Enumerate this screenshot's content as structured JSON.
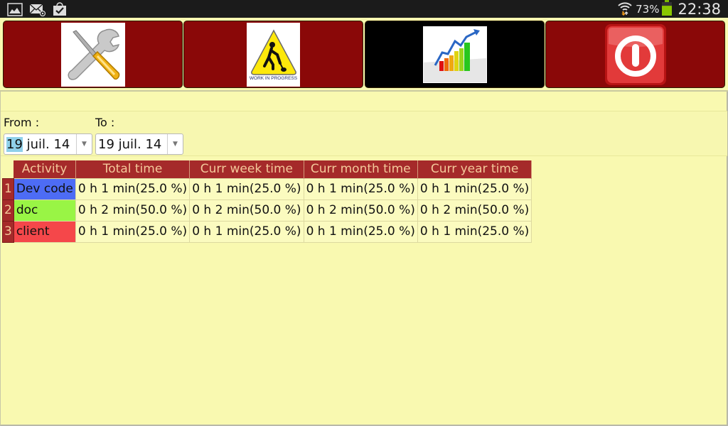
{
  "status_bar": {
    "left_icons": [
      "gallery-icon",
      "email-icon",
      "task-check-icon"
    ],
    "wifi_icon": "wifi-icon",
    "battery_percent": "73%",
    "battery_level": 0.73,
    "time": "22:38"
  },
  "toolbar": {
    "buttons": [
      {
        "name": "settings",
        "icon": "tools-icon"
      },
      {
        "name": "work-in-progress",
        "icon": "work-in-progress-icon",
        "icon_caption": "WORK IN PROGRESS"
      },
      {
        "name": "statistics",
        "icon": "growth-chart-icon"
      },
      {
        "name": "power",
        "icon": "power-icon"
      }
    ]
  },
  "filters": {
    "from_label": "From :",
    "from_value_day": "19",
    "from_value_rest": " juil. 14",
    "to_label": "To :",
    "to_value": "19 juil. 14"
  },
  "table": {
    "headers": [
      "Activity",
      "Total time",
      "Curr week time",
      "Curr month time",
      "Curr year time"
    ],
    "rows": [
      {
        "num": "1",
        "activity": "Dev code",
        "color": "#4d6cf5",
        "cells": [
          "0 h 1 min(25.0 %)",
          "0 h 1 min(25.0 %)",
          "0 h 1 min(25.0 %)",
          "0 h 1 min(25.0 %)"
        ]
      },
      {
        "num": "2",
        "activity": "doc",
        "color": "#99f545",
        "cells": [
          "0 h 2 min(50.0 %)",
          "0 h 2 min(50.0 %)",
          "0 h 2 min(50.0 %)",
          "0 h 2 min(50.0 %)"
        ]
      },
      {
        "num": "3",
        "activity": "client",
        "color": "#f5474a",
        "cells": [
          "0 h 1 min(25.0 %)",
          "0 h 1 min(25.0 %)",
          "0 h 1 min(25.0 %)",
          "0 h 1 min(25.0 %)"
        ]
      }
    ]
  },
  "colors": {
    "background": "#f9f9b0",
    "button_red": "#8a0808",
    "header_red": "#a52a2a",
    "header_text": "#f4c89a"
  }
}
